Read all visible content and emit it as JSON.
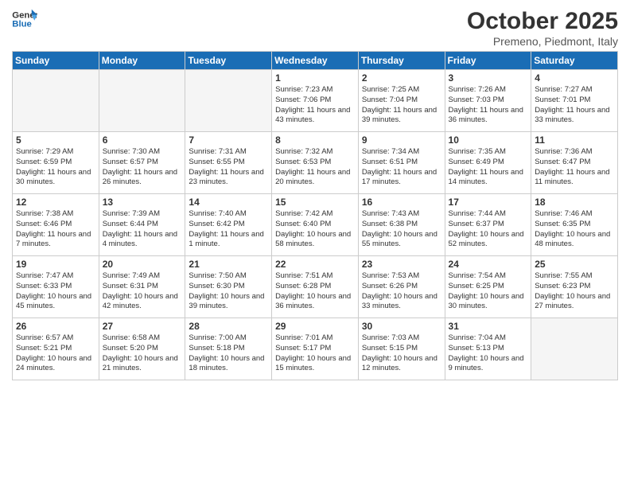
{
  "header": {
    "logo_line1": "General",
    "logo_line2": "Blue",
    "title": "October 2025",
    "subtitle": "Premeno, Piedmont, Italy"
  },
  "weekdays": [
    "Sunday",
    "Monday",
    "Tuesday",
    "Wednesday",
    "Thursday",
    "Friday",
    "Saturday"
  ],
  "weeks": [
    [
      {
        "day": "",
        "info": "",
        "empty": true
      },
      {
        "day": "",
        "info": "",
        "empty": true
      },
      {
        "day": "",
        "info": "",
        "empty": true
      },
      {
        "day": "1",
        "info": "Sunrise: 7:23 AM\nSunset: 7:06 PM\nDaylight: 11 hours\nand 43 minutes.",
        "empty": false
      },
      {
        "day": "2",
        "info": "Sunrise: 7:25 AM\nSunset: 7:04 PM\nDaylight: 11 hours\nand 39 minutes.",
        "empty": false
      },
      {
        "day": "3",
        "info": "Sunrise: 7:26 AM\nSunset: 7:03 PM\nDaylight: 11 hours\nand 36 minutes.",
        "empty": false
      },
      {
        "day": "4",
        "info": "Sunrise: 7:27 AM\nSunset: 7:01 PM\nDaylight: 11 hours\nand 33 minutes.",
        "empty": false
      }
    ],
    [
      {
        "day": "5",
        "info": "Sunrise: 7:29 AM\nSunset: 6:59 PM\nDaylight: 11 hours\nand 30 minutes.",
        "empty": false
      },
      {
        "day": "6",
        "info": "Sunrise: 7:30 AM\nSunset: 6:57 PM\nDaylight: 11 hours\nand 26 minutes.",
        "empty": false
      },
      {
        "day": "7",
        "info": "Sunrise: 7:31 AM\nSunset: 6:55 PM\nDaylight: 11 hours\nand 23 minutes.",
        "empty": false
      },
      {
        "day": "8",
        "info": "Sunrise: 7:32 AM\nSunset: 6:53 PM\nDaylight: 11 hours\nand 20 minutes.",
        "empty": false
      },
      {
        "day": "9",
        "info": "Sunrise: 7:34 AM\nSunset: 6:51 PM\nDaylight: 11 hours\nand 17 minutes.",
        "empty": false
      },
      {
        "day": "10",
        "info": "Sunrise: 7:35 AM\nSunset: 6:49 PM\nDaylight: 11 hours\nand 14 minutes.",
        "empty": false
      },
      {
        "day": "11",
        "info": "Sunrise: 7:36 AM\nSunset: 6:47 PM\nDaylight: 11 hours\nand 11 minutes.",
        "empty": false
      }
    ],
    [
      {
        "day": "12",
        "info": "Sunrise: 7:38 AM\nSunset: 6:46 PM\nDaylight: 11 hours\nand 7 minutes.",
        "empty": false
      },
      {
        "day": "13",
        "info": "Sunrise: 7:39 AM\nSunset: 6:44 PM\nDaylight: 11 hours\nand 4 minutes.",
        "empty": false
      },
      {
        "day": "14",
        "info": "Sunrise: 7:40 AM\nSunset: 6:42 PM\nDaylight: 11 hours\nand 1 minute.",
        "empty": false
      },
      {
        "day": "15",
        "info": "Sunrise: 7:42 AM\nSunset: 6:40 PM\nDaylight: 10 hours\nand 58 minutes.",
        "empty": false
      },
      {
        "day": "16",
        "info": "Sunrise: 7:43 AM\nSunset: 6:38 PM\nDaylight: 10 hours\nand 55 minutes.",
        "empty": false
      },
      {
        "day": "17",
        "info": "Sunrise: 7:44 AM\nSunset: 6:37 PM\nDaylight: 10 hours\nand 52 minutes.",
        "empty": false
      },
      {
        "day": "18",
        "info": "Sunrise: 7:46 AM\nSunset: 6:35 PM\nDaylight: 10 hours\nand 48 minutes.",
        "empty": false
      }
    ],
    [
      {
        "day": "19",
        "info": "Sunrise: 7:47 AM\nSunset: 6:33 PM\nDaylight: 10 hours\nand 45 minutes.",
        "empty": false
      },
      {
        "day": "20",
        "info": "Sunrise: 7:49 AM\nSunset: 6:31 PM\nDaylight: 10 hours\nand 42 minutes.",
        "empty": false
      },
      {
        "day": "21",
        "info": "Sunrise: 7:50 AM\nSunset: 6:30 PM\nDaylight: 10 hours\nand 39 minutes.",
        "empty": false
      },
      {
        "day": "22",
        "info": "Sunrise: 7:51 AM\nSunset: 6:28 PM\nDaylight: 10 hours\nand 36 minutes.",
        "empty": false
      },
      {
        "day": "23",
        "info": "Sunrise: 7:53 AM\nSunset: 6:26 PM\nDaylight: 10 hours\nand 33 minutes.",
        "empty": false
      },
      {
        "day": "24",
        "info": "Sunrise: 7:54 AM\nSunset: 6:25 PM\nDaylight: 10 hours\nand 30 minutes.",
        "empty": false
      },
      {
        "day": "25",
        "info": "Sunrise: 7:55 AM\nSunset: 6:23 PM\nDaylight: 10 hours\nand 27 minutes.",
        "empty": false
      }
    ],
    [
      {
        "day": "26",
        "info": "Sunrise: 6:57 AM\nSunset: 5:21 PM\nDaylight: 10 hours\nand 24 minutes.",
        "empty": false
      },
      {
        "day": "27",
        "info": "Sunrise: 6:58 AM\nSunset: 5:20 PM\nDaylight: 10 hours\nand 21 minutes.",
        "empty": false
      },
      {
        "day": "28",
        "info": "Sunrise: 7:00 AM\nSunset: 5:18 PM\nDaylight: 10 hours\nand 18 minutes.",
        "empty": false
      },
      {
        "day": "29",
        "info": "Sunrise: 7:01 AM\nSunset: 5:17 PM\nDaylight: 10 hours\nand 15 minutes.",
        "empty": false
      },
      {
        "day": "30",
        "info": "Sunrise: 7:03 AM\nSunset: 5:15 PM\nDaylight: 10 hours\nand 12 minutes.",
        "empty": false
      },
      {
        "day": "31",
        "info": "Sunrise: 7:04 AM\nSunset: 5:13 PM\nDaylight: 10 hours\nand 9 minutes.",
        "empty": false
      },
      {
        "day": "",
        "info": "",
        "empty": true
      }
    ]
  ]
}
